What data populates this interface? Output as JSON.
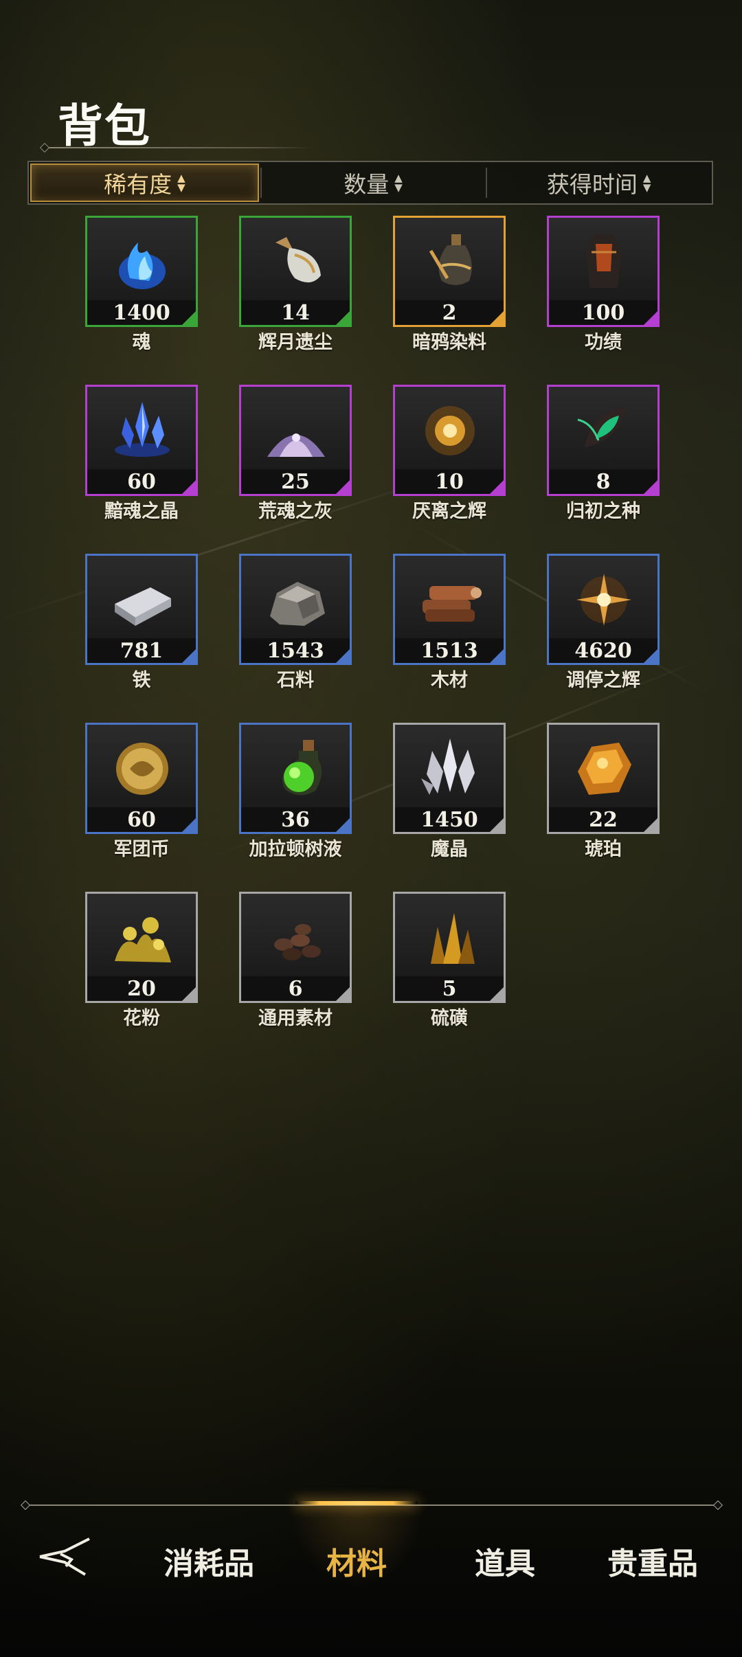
{
  "title": "背包",
  "sort_tabs": [
    {
      "label": "稀有度",
      "active": true
    },
    {
      "label": "数量",
      "active": false
    },
    {
      "label": "获得时间",
      "active": false
    }
  ],
  "items": [
    {
      "name": "魂",
      "qty": "1400",
      "rarity": "green",
      "icon": "blue-soul-flame-icon"
    },
    {
      "name": "辉月遗尘",
      "qty": "14",
      "rarity": "green",
      "icon": "moonlight-dust-bottle-icon"
    },
    {
      "name": "暗鸦染料",
      "qty": "2",
      "rarity": "gold",
      "icon": "dark-raven-dye-bottle-icon"
    },
    {
      "name": "功绩",
      "qty": "100",
      "rarity": "purple",
      "icon": "merit-armor-icon"
    },
    {
      "name": "黯魂之晶",
      "qty": "60",
      "rarity": "purple",
      "icon": "blue-crystal-icon"
    },
    {
      "name": "荒魂之灰",
      "qty": "25",
      "rarity": "purple",
      "icon": "ash-pile-icon"
    },
    {
      "name": "厌离之辉",
      "qty": "10",
      "rarity": "purple",
      "icon": "golden-radiance-icon"
    },
    {
      "name": "归初之种",
      "qty": "8",
      "rarity": "purple",
      "icon": "green-seed-icon"
    },
    {
      "name": "铁",
      "qty": "781",
      "rarity": "blue",
      "icon": "iron-ingot-icon"
    },
    {
      "name": "石料",
      "qty": "1543",
      "rarity": "blue",
      "icon": "stone-icon"
    },
    {
      "name": "木材",
      "qty": "1513",
      "rarity": "blue",
      "icon": "wood-logs-icon"
    },
    {
      "name": "调停之辉",
      "qty": "4620",
      "rarity": "blue",
      "icon": "orange-glow-icon"
    },
    {
      "name": "军团币",
      "qty": "60",
      "rarity": "blue",
      "icon": "legion-coin-icon"
    },
    {
      "name": "加拉顿树液",
      "qty": "36",
      "rarity": "blue",
      "icon": "green-sap-flask-icon"
    },
    {
      "name": "魔晶",
      "qty": "1450",
      "rarity": "gray",
      "icon": "white-crystal-icon"
    },
    {
      "name": "琥珀",
      "qty": "22",
      "rarity": "gray",
      "icon": "amber-icon"
    },
    {
      "name": "花粉",
      "qty": "20",
      "rarity": "gray",
      "icon": "pollen-icon"
    },
    {
      "name": "通用素材",
      "qty": "6",
      "rarity": "gray",
      "icon": "generic-material-icon"
    },
    {
      "name": "硫磺",
      "qty": "5",
      "rarity": "gray",
      "icon": "sulfur-crystal-icon"
    }
  ],
  "bottom_nav": {
    "back_icon": "back-arrow-icon",
    "tabs": [
      {
        "label": "消耗品",
        "active": false
      },
      {
        "label": "材料",
        "active": true
      },
      {
        "label": "道具",
        "active": false
      },
      {
        "label": "贵重品",
        "active": false
      }
    ]
  },
  "colors": {
    "green": "#3aa63a",
    "gold": "#e3a233",
    "purple": "#b43fd1",
    "blue": "#4b74c7",
    "gray": "#a7a7a7",
    "active_tab": "#e8b446"
  }
}
